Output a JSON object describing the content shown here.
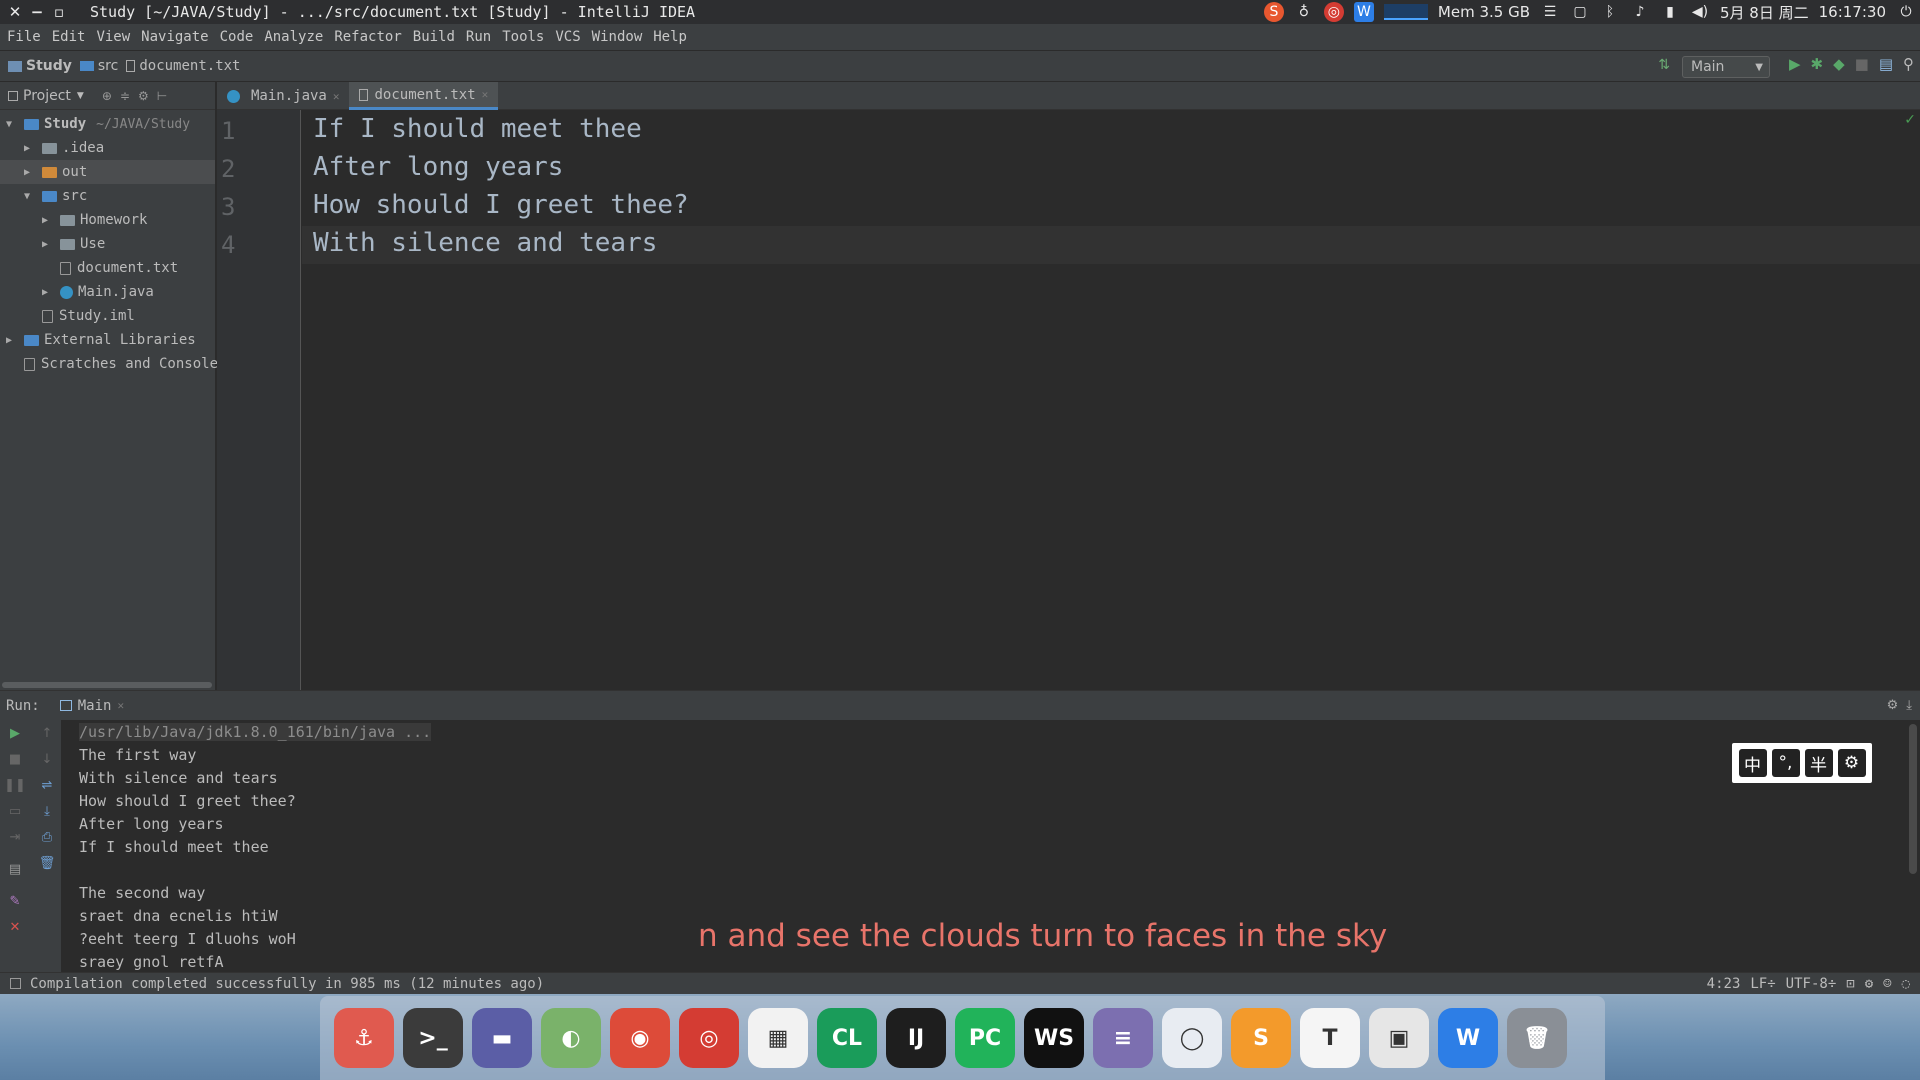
{
  "window": {
    "title": "Study [~/JAVA/Study] - .../src/document.txt [Study] - IntelliJ IDEA",
    "close": "✕",
    "minimize": "−",
    "maximize": "▫"
  },
  "tray": {
    "mem": "Mem 3.5 GB",
    "date": "5月 8日 周二",
    "time": "16:17:30"
  },
  "menu": [
    "File",
    "Edit",
    "View",
    "Navigate",
    "Code",
    "Analyze",
    "Refactor",
    "Build",
    "Run",
    "Tools",
    "VCS",
    "Window",
    "Help"
  ],
  "breadcrumb": [
    "Study",
    "src",
    "document.txt"
  ],
  "run_config": "Main",
  "project_panel": {
    "title": "Project",
    "tree": [
      {
        "label": "Study",
        "hint": "~/JAVA/Study",
        "depth": 0,
        "arrow": "▼",
        "type": "module"
      },
      {
        "label": ".idea",
        "depth": 1,
        "arrow": "▶",
        "type": "folder"
      },
      {
        "label": "out",
        "depth": 1,
        "arrow": "▶",
        "type": "folder-orange"
      },
      {
        "label": "src",
        "depth": 1,
        "arrow": "▼",
        "type": "folder-blue"
      },
      {
        "label": "Homework",
        "depth": 2,
        "arrow": "▶",
        "type": "package"
      },
      {
        "label": "Use",
        "depth": 2,
        "arrow": "▶",
        "type": "package"
      },
      {
        "label": "document.txt",
        "depth": 2,
        "arrow": "",
        "type": "file"
      },
      {
        "label": "Main.java",
        "depth": 2,
        "arrow": "▶",
        "type": "java"
      },
      {
        "label": "Study.iml",
        "depth": 1,
        "arrow": "",
        "type": "file"
      },
      {
        "label": "External Libraries",
        "depth": 0,
        "arrow": "▶",
        "type": "lib"
      },
      {
        "label": "Scratches and Consoles",
        "depth": 0,
        "arrow": "",
        "type": "scratch"
      }
    ]
  },
  "editor_tabs": [
    {
      "label": "Main.java",
      "active": false
    },
    {
      "label": "document.txt",
      "active": true
    }
  ],
  "editor": {
    "line_numbers": [
      "1",
      "2",
      "3",
      "4"
    ],
    "lines": [
      "If I should meet thee",
      "After long years",
      "How should I greet thee?",
      "With silence and tears"
    ]
  },
  "run_panel": {
    "label": "Run:",
    "tab": "Main",
    "console": [
      "/usr/lib/Java/jdk1.8.0_161/bin/java ...",
      "The first way",
      "With silence and tears",
      "How should I greet thee?",
      "After long years",
      "If I should meet thee",
      "",
      "The second way",
      "sraet dna ecnelis htiW",
      "?eeht teerg I dluohs woH",
      "sraey gnol retfA"
    ]
  },
  "ime": [
    "中",
    "°,",
    "半",
    "⚙"
  ],
  "subtitle": "n and see the clouds turn to faces in the sky",
  "status": {
    "message": "Compilation completed successfully in 985 ms (12 minutes ago)",
    "position": "4:23",
    "line_sep": "LF÷",
    "encoding": "UTF-8÷"
  },
  "dock": [
    {
      "name": "anchor",
      "glyph": "⚓",
      "color": "#e05a4f"
    },
    {
      "name": "terminal",
      "glyph": ">_",
      "color": "#3b3b3b"
    },
    {
      "name": "files",
      "glyph": "▬",
      "color": "#5b5ea6"
    },
    {
      "name": "toggle",
      "glyph": "◐",
      "color": "#7ab26a"
    },
    {
      "name": "chrome",
      "glyph": "◉",
      "color": "#dd4b39"
    },
    {
      "name": "netease-music",
      "glyph": "◎",
      "color": "#d43c33"
    },
    {
      "name": "app-store",
      "glyph": "▦",
      "color": "#f2f2f2"
    },
    {
      "name": "clion",
      "glyph": "CL",
      "color": "#1a9c5a"
    },
    {
      "name": "intellij",
      "glyph": "IJ",
      "color": "#1e1e1e"
    },
    {
      "name": "pycharm",
      "glyph": "PC",
      "color": "#21b35a"
    },
    {
      "name": "webstorm",
      "glyph": "WS",
      "color": "#111111"
    },
    {
      "name": "text-editor",
      "glyph": "≡",
      "color": "#7c6fb0"
    },
    {
      "name": "browser",
      "glyph": "◯",
      "color": "#e8ecf2"
    },
    {
      "name": "sublime",
      "glyph": "S",
      "color": "#f39a2b"
    },
    {
      "name": "typora",
      "glyph": "T",
      "color": "#f5f5f5"
    },
    {
      "name": "remote-desktop",
      "glyph": "▣",
      "color": "#e6e6e6"
    },
    {
      "name": "wps",
      "glyph": "W",
      "color": "#2d7ee6"
    },
    {
      "name": "trash",
      "glyph": "🗑",
      "color": "#8a8f96"
    }
  ]
}
